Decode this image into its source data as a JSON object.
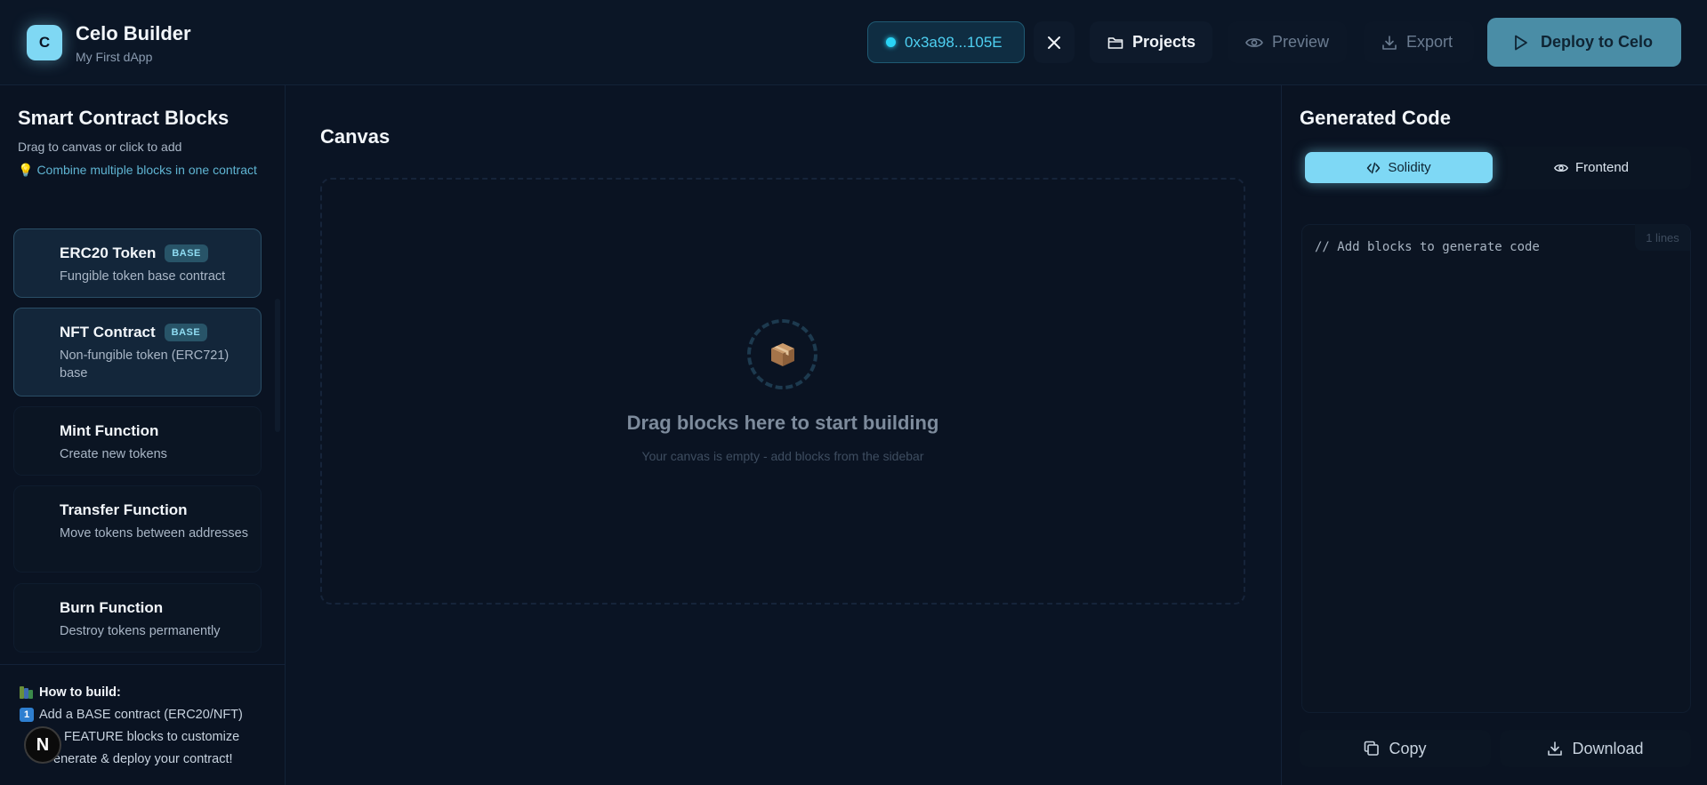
{
  "header": {
    "logo_letter": "C",
    "app_title": "Celo Builder",
    "app_subtitle": "My First dApp",
    "wallet_address": "0x3a98...105E",
    "projects_label": "Projects",
    "preview_label": "Preview",
    "export_label": "Export",
    "deploy_label": "Deploy to Celo",
    "accent_color": "#7fd8f4"
  },
  "sidebar": {
    "title": "Smart Contract Blocks",
    "subtitle": "Drag to canvas or click to add",
    "tip": "Combine multiple blocks in one contract",
    "blocks": [
      {
        "name": "ERC20 Token",
        "badge": "BASE",
        "desc": "Fungible token base contract"
      },
      {
        "name": "NFT Contract",
        "badge": "BASE",
        "desc": "Non-fungible token (ERC721) base"
      },
      {
        "name": "Mint Function",
        "desc": "Create new tokens"
      },
      {
        "name": "Transfer Function",
        "desc": "Move tokens between addresses"
      },
      {
        "name": "Burn Function",
        "desc": "Destroy tokens permanently"
      }
    ],
    "howto": {
      "heading": "How to build:",
      "steps": [
        "Add a BASE contract (ERC20/NFT)",
        "Add FEATURE blocks to customize",
        "Generate & deploy your contract!"
      ],
      "step_visible_text": [
        "Add a BASE contract (ERC20/NFT)",
        "FEATURE blocks to customize",
        "enerate & deploy your contract!"
      ]
    },
    "n_badge": "N"
  },
  "canvas": {
    "title": "Canvas",
    "empty_title": "Drag blocks here to start building",
    "empty_subtitle": "Your canvas is empty - add blocks from the sidebar"
  },
  "code_panel": {
    "title": "Generated Code",
    "tabs": [
      {
        "label": "Solidity",
        "active": true
      },
      {
        "label": "Frontend",
        "active": false
      }
    ],
    "lines_count": "1 lines",
    "code": "// Add blocks to generate code",
    "copy_label": "Copy",
    "download_label": "Download"
  }
}
